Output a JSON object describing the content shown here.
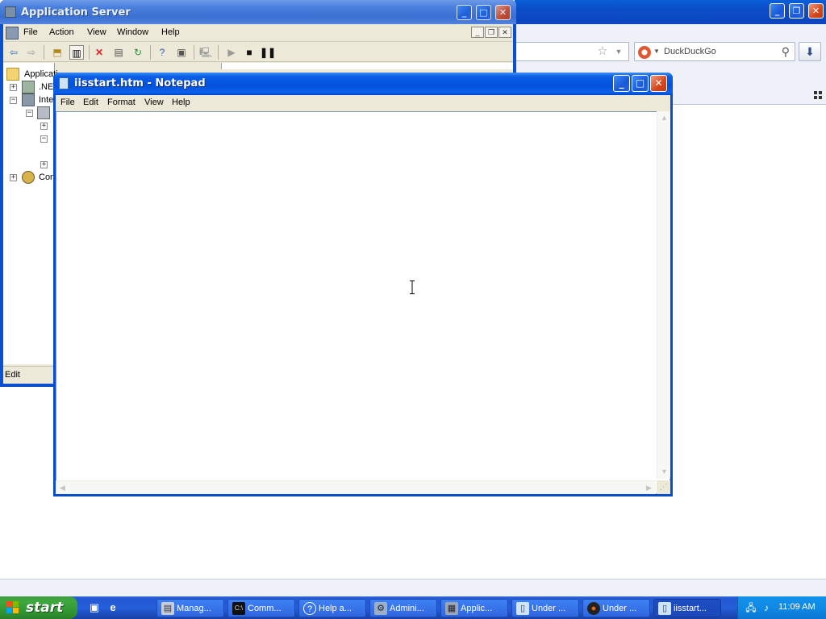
{
  "firefox": {
    "search_engine": "DuckDuckGo",
    "search_icon": "magnifier-icon",
    "download_icon": "download-arrow-icon"
  },
  "app_server": {
    "title": "Application Server",
    "menu": [
      "File",
      "Action",
      "View",
      "Window",
      "Help"
    ],
    "tree": {
      "root": "Applicati",
      "net": ".NE",
      "iis": "Inte",
      "com": "Com"
    },
    "status": "Edit"
  },
  "notepad": {
    "title": "iisstart.htm - Notepad",
    "menu": [
      "File",
      "Edit",
      "Format",
      "View",
      "Help"
    ],
    "content": ""
  },
  "taskbar": {
    "start_label": "start",
    "tasks": [
      {
        "label": "Manag...",
        "icon": "computer-management-icon"
      },
      {
        "label": "Comm...",
        "icon": "command-prompt-icon"
      },
      {
        "label": "Help a...",
        "icon": "help-icon"
      },
      {
        "label": "Admini...",
        "icon": "admin-tools-icon"
      },
      {
        "label": "Applic...",
        "icon": "application-server-icon"
      },
      {
        "label": "Under ...",
        "icon": "notepad-icon"
      },
      {
        "label": "Under ...",
        "icon": "firefox-icon"
      },
      {
        "label": "iisstart...",
        "icon": "notepad-icon"
      }
    ],
    "clock": "11:09 AM"
  },
  "colors": {
    "xp_blue": "#0a4ccb",
    "start_green": "#3fa83f",
    "tray_blue": "#0f8ae5"
  }
}
